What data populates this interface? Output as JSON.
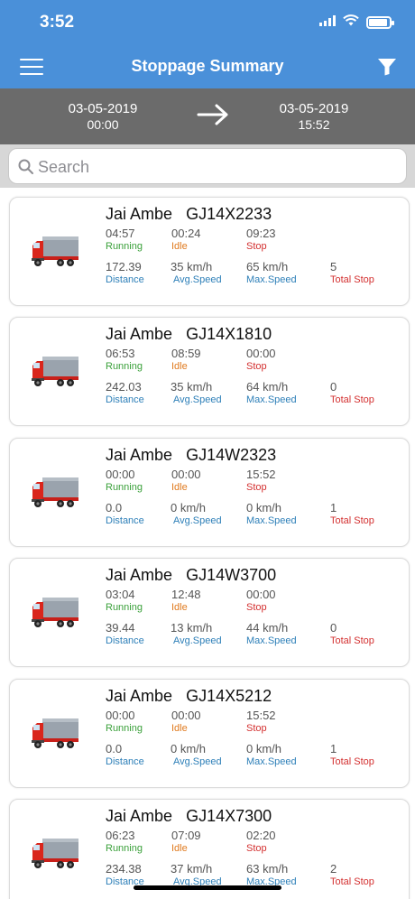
{
  "status": {
    "time": "3:52",
    "battery_level": 0.92
  },
  "nav": {
    "title": "Stoppage Summary",
    "menu_icon": "hamburger-menu-icon",
    "filter_icon": "filter-funnel-icon"
  },
  "date_range": {
    "from_date": "03-05-2019",
    "from_time": "00:00",
    "to_date": "03-05-2019",
    "to_time": "15:52"
  },
  "search": {
    "placeholder": "Search",
    "value": ""
  },
  "labels": {
    "running": "Running",
    "idle": "Idle",
    "stop": "Stop",
    "distance": "Distance",
    "avg_speed": "Avg.Speed",
    "max_speed": "Max.Speed",
    "total_stop": "Total Stop"
  },
  "colors": {
    "header": "#4a90d9",
    "date_bar": "#6b6b6b",
    "running": "#3aa03a",
    "idle": "#e07a1f",
    "stop": "#d32f2f",
    "info": "#2d7fb8"
  },
  "vehicles": [
    {
      "name": "Jai Ambe",
      "plate": "GJ14X2233",
      "running": "04:57",
      "idle": "00:24",
      "stop": "09:23",
      "distance": "172.39",
      "avg_speed": "35 km/h",
      "max_speed": "65 km/h",
      "total_stop": "5"
    },
    {
      "name": "Jai Ambe",
      "plate": "GJ14X1810",
      "running": "06:53",
      "idle": "08:59",
      "stop": "00:00",
      "distance": "242.03",
      "avg_speed": "35 km/h",
      "max_speed": "64 km/h",
      "total_stop": "0"
    },
    {
      "name": "Jai Ambe",
      "plate": "GJ14W2323",
      "running": "00:00",
      "idle": "00:00",
      "stop": "15:52",
      "distance": "0.0",
      "avg_speed": "0 km/h",
      "max_speed": "0 km/h",
      "total_stop": "1"
    },
    {
      "name": "Jai Ambe",
      "plate": "GJ14W3700",
      "running": "03:04",
      "idle": "12:48",
      "stop": "00:00",
      "distance": "39.44",
      "avg_speed": "13 km/h",
      "max_speed": "44 km/h",
      "total_stop": "0"
    },
    {
      "name": "Jai Ambe",
      "plate": "GJ14X5212",
      "running": "00:00",
      "idle": "00:00",
      "stop": "15:52",
      "distance": "0.0",
      "avg_speed": "0 km/h",
      "max_speed": "0 km/h",
      "total_stop": "1"
    },
    {
      "name": "Jai Ambe",
      "plate": "GJ14X7300",
      "running": "06:23",
      "idle": "07:09",
      "stop": "02:20",
      "distance": "234.38",
      "avg_speed": "37 km/h",
      "max_speed": "63 km/h",
      "total_stop": "2"
    }
  ]
}
